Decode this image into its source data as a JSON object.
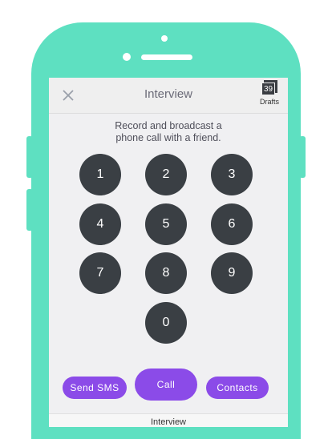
{
  "header": {
    "title": "Interview",
    "close_icon": "close-icon",
    "drafts_count": "39",
    "drafts_label": "Drafts"
  },
  "instructions": {
    "line1": "Record and broadcast a",
    "line2": "phone call with a friend."
  },
  "keypad": {
    "keys": [
      "1",
      "2",
      "3",
      "4",
      "5",
      "6",
      "7",
      "8",
      "9",
      "0"
    ]
  },
  "actions": {
    "sms_label": "Send SMS",
    "call_label": "Call",
    "contacts_label": "Contacts"
  },
  "footer": {
    "label": "Interview"
  },
  "colors": {
    "phone_body": "#5ee0c1",
    "key_bg": "#3a3f44",
    "accent": "#8b4be8"
  }
}
